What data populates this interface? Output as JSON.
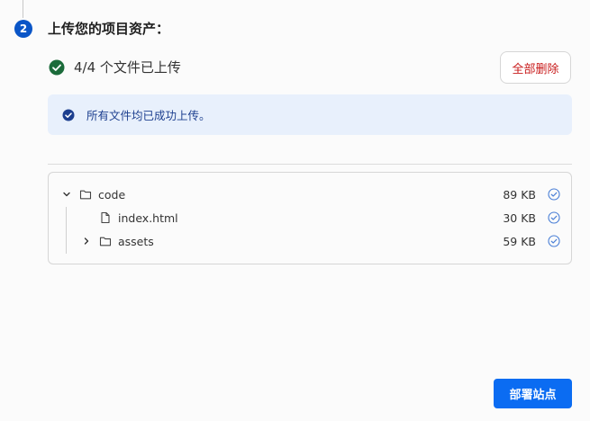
{
  "step": {
    "number": "2",
    "title": "上传您的项目资产："
  },
  "upload_status": {
    "text": "4/4 个文件已上传",
    "delete_all_label": "全部删除"
  },
  "banner": {
    "text": "所有文件均已成功上传。"
  },
  "file_tree": {
    "items": [
      {
        "name": "code",
        "type": "folder",
        "expanded": true,
        "size": "89 KB",
        "status": "uploaded"
      },
      {
        "name": "index.html",
        "type": "file",
        "size": "30 KB",
        "status": "uploaded"
      },
      {
        "name": "assets",
        "type": "folder",
        "expanded": false,
        "size": "59 KB",
        "status": "uploaded"
      }
    ]
  },
  "footer": {
    "deploy_label": "部署站点"
  },
  "colors": {
    "primary": "#0b6cf2",
    "success": "#1b6b3a",
    "danger": "#c81a1a",
    "banner_bg": "#e8f0fc",
    "banner_text": "#1d3f8f"
  }
}
